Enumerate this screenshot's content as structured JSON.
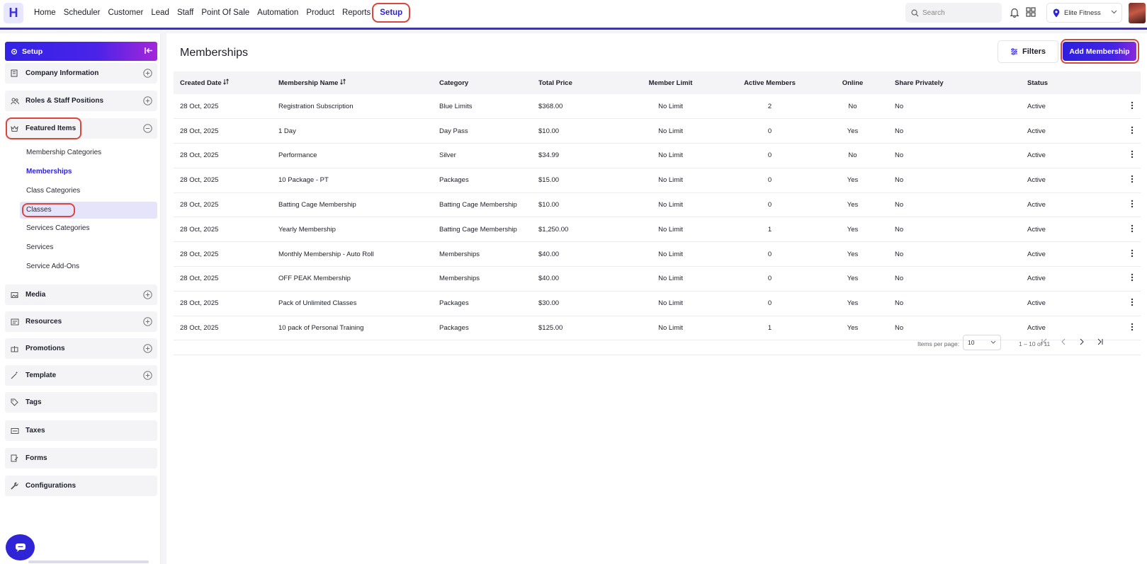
{
  "brand": {
    "logo_letter": "H",
    "accent": "#2e22d8",
    "highlight": "#d9463e"
  },
  "nav": {
    "links": [
      "Home",
      "Scheduler",
      "Customer",
      "Lead",
      "Staff",
      "Point Of Sale",
      "Automation",
      "Product",
      "Reports"
    ],
    "active": "Setup",
    "search_placeholder": "Search",
    "location": "Elite Fitness"
  },
  "sidebar": {
    "header": "Setup",
    "sections": [
      {
        "label": "Company Information",
        "icon": "building-icon",
        "toggle": "plus"
      },
      {
        "label": "Roles & Staff Positions",
        "icon": "users-icon",
        "toggle": "plus"
      },
      {
        "label": "Featured Items",
        "icon": "crown-icon",
        "toggle": "minus"
      }
    ],
    "featured_items": [
      "Membership Categories",
      "Memberships",
      "Class Categories",
      "Classes",
      "Services Categories",
      "Services",
      "Service Add-Ons"
    ],
    "active_item": "Memberships",
    "more_sections": [
      {
        "label": "Media",
        "icon": "image-icon",
        "toggle": "plus"
      },
      {
        "label": "Resources",
        "icon": "resources-icon",
        "toggle": "plus"
      },
      {
        "label": "Promotions",
        "icon": "gift-icon",
        "toggle": "plus"
      },
      {
        "label": "Template",
        "icon": "wand-icon",
        "toggle": "plus"
      },
      {
        "label": "Tags",
        "icon": "tag-icon"
      },
      {
        "label": "Taxes",
        "icon": "tax-icon"
      },
      {
        "label": "Forms",
        "icon": "form-icon"
      },
      {
        "label": "Configurations",
        "icon": "wrench-icon"
      }
    ]
  },
  "main": {
    "title": "Memberships",
    "filters_label": "Filters",
    "add_label": "Add Membership",
    "columns": [
      "Created Date",
      "Membership Name",
      "Category",
      "Total Price",
      "Member Limit",
      "Active Members",
      "Online",
      "Share Privately",
      "Status"
    ],
    "rows": [
      [
        "28 Oct, 2025",
        "Registration Subscription",
        "Blue Limits",
        "$368.00",
        "No Limit",
        "2",
        "No",
        "No",
        "Active"
      ],
      [
        "28 Oct, 2025",
        "1 Day",
        "Day Pass",
        "$10.00",
        "No Limit",
        "0",
        "Yes",
        "No",
        "Active"
      ],
      [
        "28 Oct, 2025",
        "Performance",
        "Silver",
        "$34.99",
        "No Limit",
        "0",
        "No",
        "No",
        "Active"
      ],
      [
        "28 Oct, 2025",
        "10 Package - PT",
        "Packages",
        "$15.00",
        "No Limit",
        "0",
        "Yes",
        "No",
        "Active"
      ],
      [
        "28 Oct, 2025",
        "Batting Cage Membership",
        "Batting Cage Membership",
        "$10.00",
        "No Limit",
        "0",
        "Yes",
        "No",
        "Active"
      ],
      [
        "28 Oct, 2025",
        "Yearly Membership",
        "Batting Cage Membership",
        "$1,250.00",
        "No Limit",
        "1",
        "Yes",
        "No",
        "Active"
      ],
      [
        "28 Oct, 2025",
        "Monthly Membership - Auto Roll",
        "Memberships",
        "$40.00",
        "No Limit",
        "0",
        "Yes",
        "No",
        "Active"
      ],
      [
        "28 Oct, 2025",
        "OFF PEAK Membership",
        "Memberships",
        "$40.00",
        "No Limit",
        "0",
        "Yes",
        "No",
        "Active"
      ],
      [
        "28 Oct, 2025",
        "Pack of Unlimited Classes",
        "Packages",
        "$30.00",
        "No Limit",
        "0",
        "Yes",
        "No",
        "Active"
      ],
      [
        "28 Oct, 2025",
        "10 pack of Personal Training",
        "Packages",
        "$125.00",
        "No Limit",
        "1",
        "Yes",
        "No",
        "Active"
      ]
    ],
    "pagination": {
      "items_per_page_label": "Items per page:",
      "items_per_page": "10",
      "range": "1 – 10 of 11"
    }
  }
}
